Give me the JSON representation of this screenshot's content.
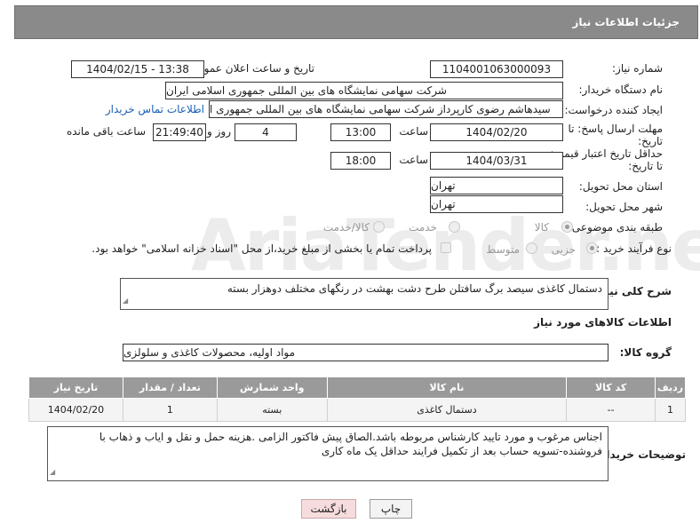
{
  "header": {
    "title": "جزئیات اطلاعات نیاز"
  },
  "fields": {
    "need_number_label": "شماره نیاز:",
    "need_number": "1104001063000093",
    "announce_label": "تاریخ و ساعت اعلان عمومی:",
    "announce_value": "1404/02/15 - 13:38",
    "buyer_label": "نام دستگاه خریدار:",
    "buyer_value": "شرکت سهامی نمایشگاه های بین المللی جمهوری اسلامی ایران",
    "creator_label": "ایجاد کننده درخواست:",
    "creator_value": "سیدهاشم رضوی کارپرداز شرکت سهامی نمایشگاه های بین المللی جمهوری ا",
    "contact_link": "اطلاعات تماس خریدار",
    "deadline_label": "مهلت ارسال پاسخ: تا تاریخ:",
    "deadline_date": "1404/02/20",
    "time_label": "ساعت",
    "deadline_time": "13:00",
    "days_value": "4",
    "days_label": "روز و",
    "remaining_time": "21:49:40",
    "remaining_label": "ساعت باقی مانده",
    "min_price_label": "حداقل تاریخ اعتبار قیمت: تا تاریخ:",
    "min_price_date": "1404/03/31",
    "min_price_time": "18:00",
    "province_label": "استان محل تحویل:",
    "province_value": "تهران",
    "city_label": "شهر محل تحویل:",
    "city_value": "تهران",
    "category_label": "طبقه بندی موضوعی:",
    "category_options": [
      "کالا",
      "خدمت",
      "کالا/خدمت"
    ],
    "category_selected": "کالا",
    "process_label": "نوع فرآیند خرید :",
    "process_options": [
      "جزیی",
      "متوسط"
    ],
    "process_selected": "جزیی",
    "payment_note": "پرداخت تمام یا بخشی از مبلغ خرید،از محل \"اسناد خزانه اسلامی\" خواهد بود."
  },
  "description": {
    "label": "شرح کلی نیاز:",
    "value": "دستمال کاغذی سیصد برگ سافتلن طرح دشت بهشت در رنگهای مختلف دوهزار بسته"
  },
  "goods_section": {
    "title": "اطلاعات کالاهای مورد نیاز",
    "group_label": "گروه کالا:",
    "group_value": "مواد اولیه، محصولات کاغذی و سلولزی"
  },
  "table": {
    "headers": [
      "ردیف",
      "کد کالا",
      "نام کالا",
      "واحد شمارش",
      "تعداد / مقدار",
      "تاریخ نیاز"
    ],
    "rows": [
      [
        "1",
        "--",
        "دستمال کاغذی",
        "بسته",
        "1",
        "1404/02/20"
      ]
    ]
  },
  "buyer_notes": {
    "label": "توضیحات خریدار:",
    "value": "اجناس مرغوب و مورد تایید کارشناس  مربوطه باشد.الصاق پیش فاکتور الزامی .هزینه حمل و نقل و ایاب و ذهاب با فروشنده-تسویه حساب بعد از تکمیل فرایند حداقل یک ماه کاری"
  },
  "buttons": {
    "print": "چاپ",
    "back": "بازگشت"
  },
  "colors": {
    "header_bg": "#8a8a8a",
    "link": "#1a5fb4",
    "back_button": "#f6dcdc"
  }
}
